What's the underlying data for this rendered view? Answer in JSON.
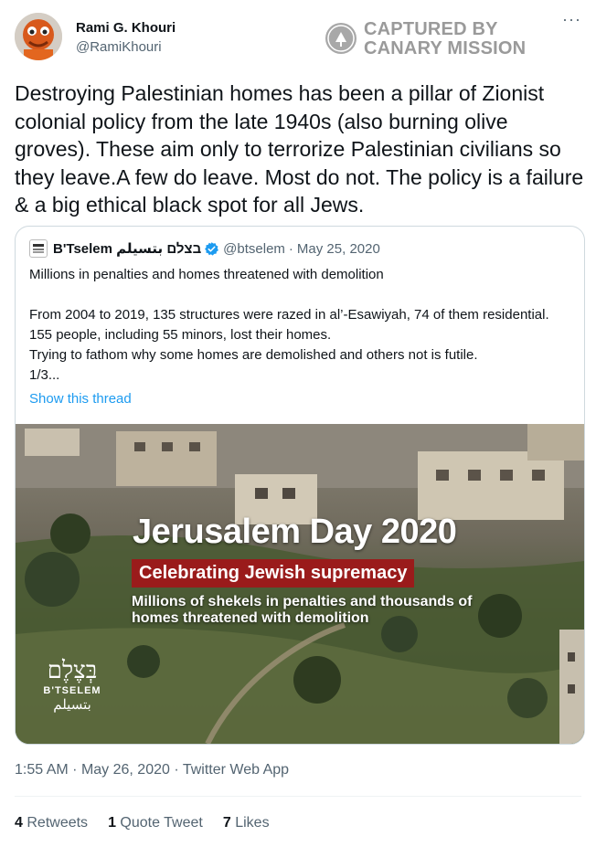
{
  "author": {
    "display_name": "Rami G. Khouri",
    "handle": "@RamiKhouri",
    "more_icon": "more-options-icon"
  },
  "stamp": {
    "line1": "CAPTURED BY",
    "line2": "CANARY MISSION",
    "icon": "canary-mission-logo"
  },
  "tweet": {
    "text": "Destroying Palestinian homes has been a pillar of Zionist colonial policy from the late 1940s (also burning olive groves). These aim only to terrorize Palestinian civilians so they leave.A few do leave. Most do not. The policy is a failure & a big ethical black spot for all Jews."
  },
  "quote": {
    "name": "B'Tselem בצלם بتسيلم",
    "handle": "@btselem",
    "separator": "·",
    "date": "May 25, 2020",
    "line1": "Millions in penalties and homes threatened with demolition",
    "line2": "From 2004 to 2019, 135 structures were razed in al’-Esawiyah, 74 of them residential. 155 people, including 55 minors, lost their homes.",
    "line3": "Trying to fathom why some homes are demolished and others not is futile.",
    "line4": "1/3...",
    "show_thread": "Show this thread",
    "image": {
      "title": "Jerusalem Day 2020",
      "banner": "Celebrating Jewish supremacy",
      "subtitle": "Millions of shekels in penalties and thousands of homes threatened with demolition",
      "logo_he": "בְּצֶלֶם",
      "logo_en": "B'TSELEM",
      "logo_ar": "بتسيلم"
    }
  },
  "meta": {
    "time": "1:55 AM",
    "separator": "·",
    "date": "May 26, 2020",
    "source": "Twitter Web App"
  },
  "stats": {
    "retweets_count": "4",
    "retweets_label": "Retweets",
    "quotes_count": "1",
    "quotes_label": "Quote Tweet",
    "likes_count": "7",
    "likes_label": "Likes"
  },
  "colors": {
    "link": "#1d9bf0",
    "muted": "#536471",
    "banner": "#9a1b1b",
    "verified": "#1d9bf0"
  }
}
